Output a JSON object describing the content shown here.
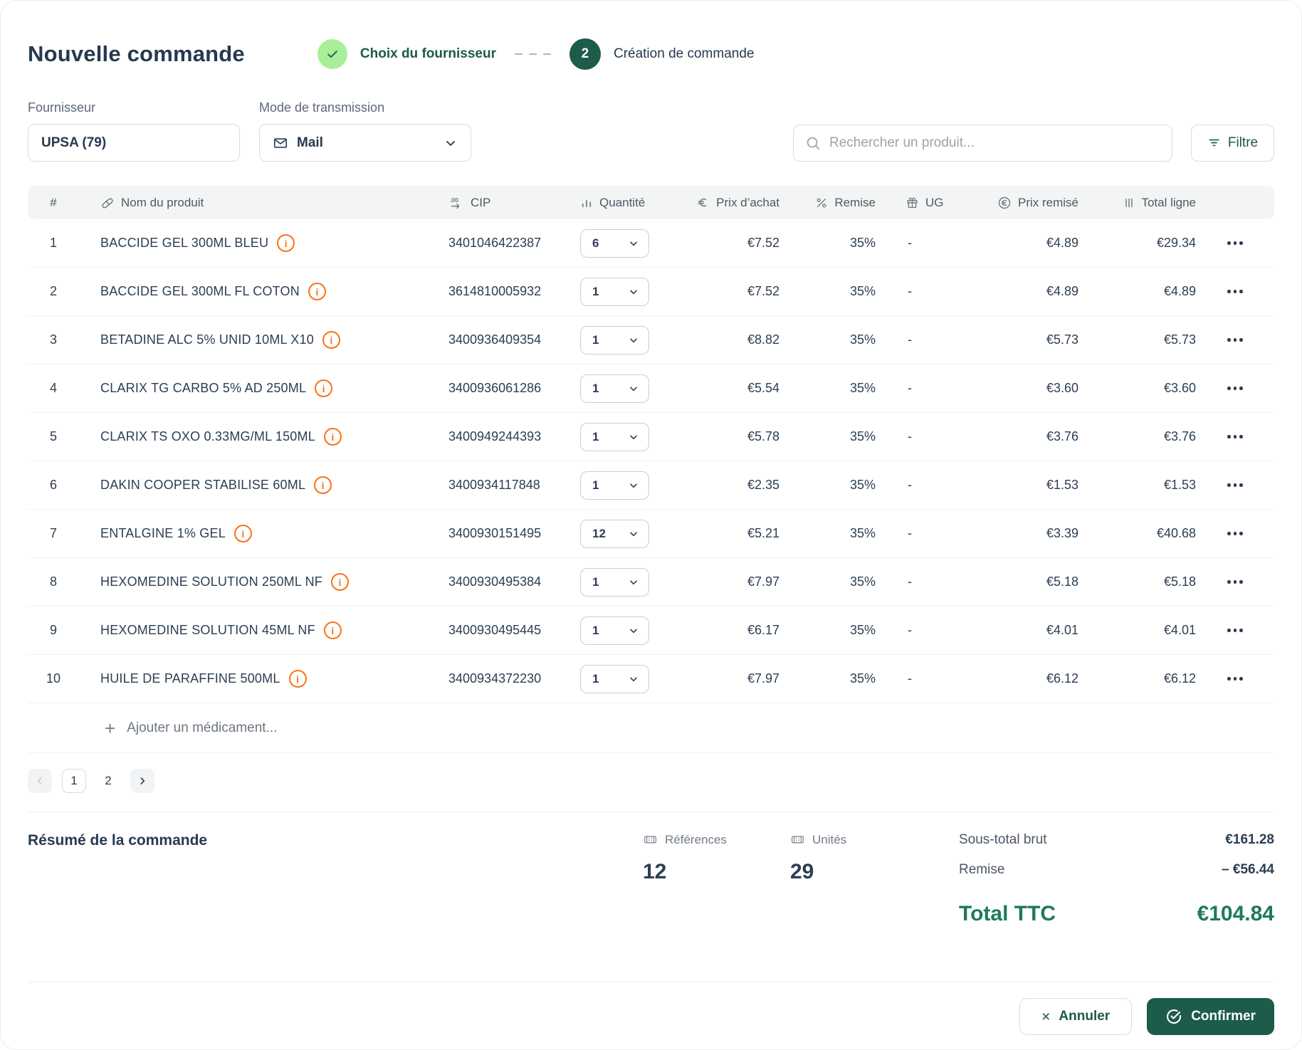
{
  "colors": {
    "navy": "#2c3e53",
    "accent_teal": "#1d5b4b",
    "light_green": "#a9ee98",
    "total_green": "#1e7b57",
    "info_orange": "#f97316",
    "header_bg": "#f3f5f4"
  },
  "header": {
    "title": "Nouvelle commande",
    "step_done_label": "Choix du fournisseur",
    "step_active_number": "2",
    "step_active_label": "Création de commande"
  },
  "filters": {
    "fournisseur_label": "Fournisseur",
    "fournisseur_value": "UPSA (79)",
    "transmission_label": "Mode de transmission",
    "transmission_value": "Mail",
    "search_placeholder": "Rechercher un produit...",
    "filter_button_label": "Filtre"
  },
  "table": {
    "columns": [
      "#",
      "Nom du produit",
      "CIP",
      "Quantité",
      "Prix d’achat",
      "Remise",
      "UG",
      "Prix remisé",
      "Total ligne"
    ],
    "rows": [
      {
        "num": "1",
        "name": "BACCIDE GEL 300ML BLEU",
        "cip": "3401046422387",
        "qty": "6",
        "achat": "€7.52",
        "remise": "35%",
        "ug": "-",
        "prix_remise": "€4.89",
        "total": "€29.34",
        "info": false
      },
      {
        "num": "2",
        "name": "BACCIDE GEL 300ML FL COTON",
        "cip": "3614810005932",
        "qty": "1",
        "achat": "€7.52",
        "remise": "35%",
        "ug": "-",
        "prix_remise": "€4.89",
        "total": "€4.89",
        "info": false
      },
      {
        "num": "3",
        "name": "BETADINE ALC 5% UNID 10ML X10",
        "cip": "3400936409354",
        "qty": "1",
        "achat": "€8.82",
        "remise": "35%",
        "ug": "-",
        "prix_remise": "€5.73",
        "total": "€5.73",
        "info": false
      },
      {
        "num": "4",
        "name": "CLARIX TG CARBO 5% AD 250ML",
        "cip": "3400936061286",
        "qty": "1",
        "achat": "€5.54",
        "remise": "35%",
        "ug": "-",
        "prix_remise": "€3.60",
        "total": "€3.60",
        "info": true
      },
      {
        "num": "5",
        "name": "CLARIX TS OXO 0.33MG/ML 150ML",
        "cip": "3400949244393",
        "qty": "1",
        "achat": "€5.78",
        "remise": "35%",
        "ug": "-",
        "prix_remise": "€3.76",
        "total": "€3.76",
        "info": false
      },
      {
        "num": "6",
        "name": "DAKIN COOPER STABILISE 60ML",
        "cip": "3400934117848",
        "qty": "1",
        "achat": "€2.35",
        "remise": "35%",
        "ug": "-",
        "prix_remise": "€1.53",
        "total": "€1.53",
        "info": false
      },
      {
        "num": "7",
        "name": "ENTALGINE 1% GEL",
        "cip": "3400930151495",
        "qty": "12",
        "achat": "€5.21",
        "remise": "35%",
        "ug": "-",
        "prix_remise": "€3.39",
        "total": "€40.68",
        "info": false
      },
      {
        "num": "8",
        "name": "HEXOMEDINE SOLUTION 250ML NF",
        "cip": "3400930495384",
        "qty": "1",
        "achat": "€7.97",
        "remise": "35%",
        "ug": "-",
        "prix_remise": "€5.18",
        "total": "€5.18",
        "info": false
      },
      {
        "num": "9",
        "name": "HEXOMEDINE SOLUTION 45ML NF",
        "cip": "3400930495445",
        "qty": "1",
        "achat": "€6.17",
        "remise": "35%",
        "ug": "-",
        "prix_remise": "€4.01",
        "total": "€4.01",
        "info": false
      },
      {
        "num": "10",
        "name": "HUILE DE PARAFFINE 500ML",
        "cip": "3400934372230",
        "qty": "1",
        "achat": "€7.97",
        "remise": "35%",
        "ug": "-",
        "prix_remise": "€6.12",
        "total": "€6.12",
        "info": false
      }
    ],
    "add_row_label": "Ajouter un médicament..."
  },
  "pagination": {
    "pages": [
      "1",
      "2"
    ],
    "current": "1"
  },
  "summary": {
    "title": "Résumé de la commande",
    "references_label": "Références",
    "references_value": "12",
    "unites_label": "Unités",
    "unites_value": "29",
    "subtotal_label": "Sous-total brut",
    "subtotal_value": "€161.28",
    "remise_label": "Remise",
    "remise_value": "– €56.44",
    "total_label": "Total TTC",
    "total_value": "€104.84"
  },
  "footer": {
    "cancel_label": "Annuler",
    "confirm_label": "Confirmer"
  }
}
